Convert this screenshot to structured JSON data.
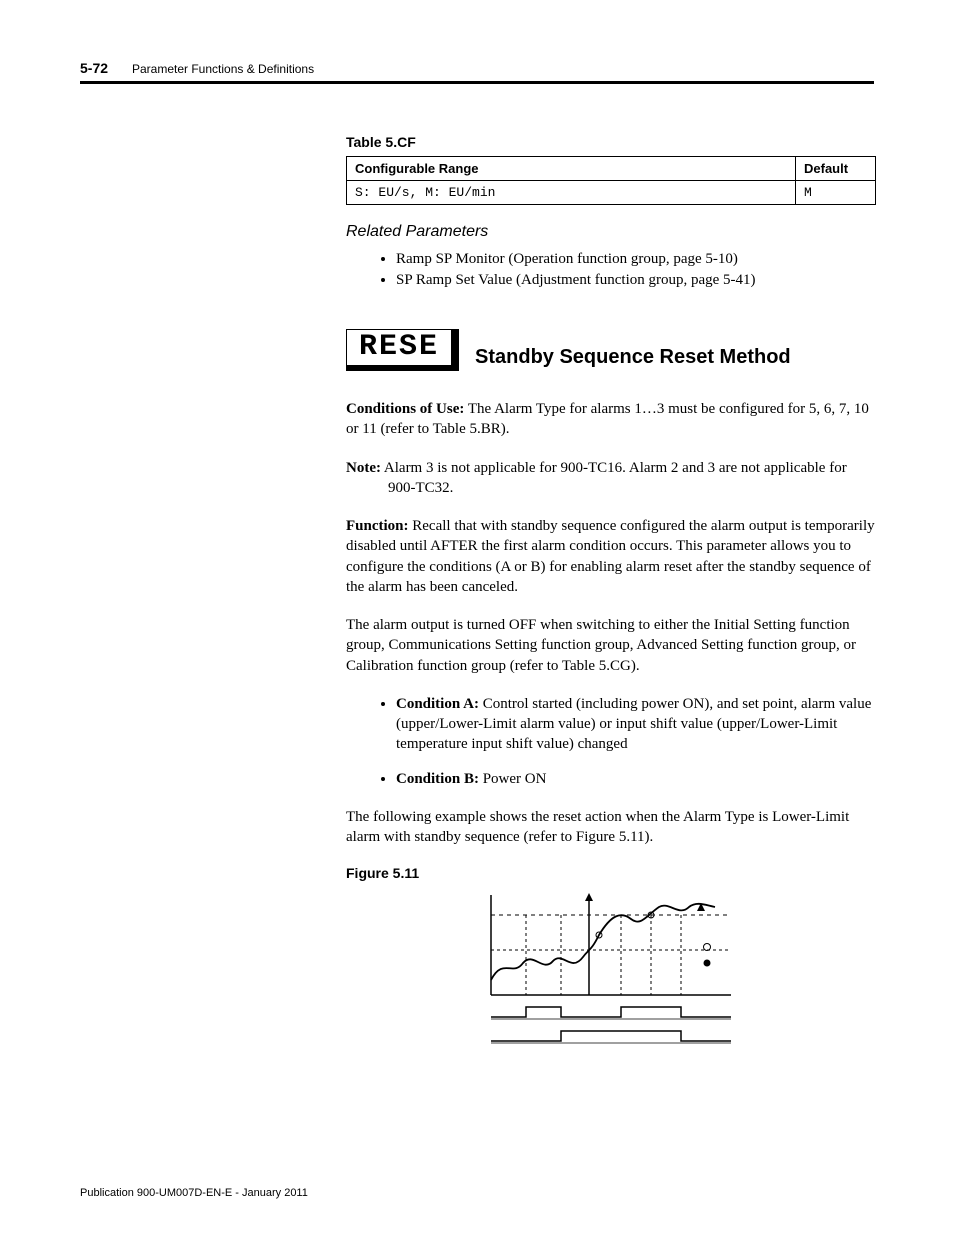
{
  "header": {
    "page_number": "5-72",
    "chapter": "Parameter Functions & Definitions"
  },
  "table_cf": {
    "caption": "Table 5.CF",
    "col_range": "Configurable Range",
    "col_default": "Default",
    "row_range": "S: EU/s, M: EU/min",
    "row_default": "M"
  },
  "related": {
    "heading": "Related Parameters",
    "items": [
      "Ramp SP Monitor (Operation function group, page 5-10)",
      "SP Ramp Set Value (Adjustment function group, page 5-41)"
    ]
  },
  "section": {
    "seg_text": "RESE",
    "title": "Standby Sequence Reset Method"
  },
  "body": {
    "cond_label": "Conditions of Use:",
    "cond_text": " The Alarm Type for alarms 1…3 must be configured for 5, 6, 7, 10 or 11 (refer to Table 5.BR).",
    "note_label": "Note:",
    "note_text": " Alarm 3 is not applicable for 900-TC16. Alarm 2 and 3 are not applicable for 900-TC32.",
    "func_label": "Function:",
    "func_text": " Recall that with standby sequence configured the alarm output is temporarily disabled until AFTER the first alarm condition occurs. This parameter allows you to configure the conditions (A or B) for enabling alarm reset after the standby sequence of the alarm has been canceled.",
    "para2": "The alarm output is turned OFF when switching to either the Initial Setting function group, Communications Setting function group, Advanced Setting function group, or Calibration function group (refer to Table 5.CG).",
    "conditions": [
      {
        "label": "Condition A:",
        "text": " Control started (including power ON), and set point, alarm value (upper/Lower-Limit alarm value) or input shift value (upper/Lower-Limit temperature input shift value) changed"
      },
      {
        "label": "Condition B:",
        "text": " Power ON"
      }
    ],
    "para3": "The following example shows the reset action when the Alarm Type is Lower-Limit alarm with standby sequence (refer to Figure 5.11)."
  },
  "figure": {
    "caption": "Figure 5.11"
  },
  "chart_data": {
    "type": "line",
    "title": "",
    "xlabel": "",
    "ylabel": "",
    "series": [
      {
        "name": "PV trace",
        "description": "Process value curve rising with oscillations, crossing alarm and setpoint thresholds"
      }
    ],
    "thresholds": [
      {
        "name": "Alarm threshold (upper dashed)",
        "style": "dashed"
      },
      {
        "name": "Set point (lower dashed)",
        "style": "dashed"
      }
    ],
    "digital_traces": [
      {
        "name": "Output A",
        "pattern": [
          0,
          1,
          0,
          1,
          0
        ]
      },
      {
        "name": "Output B",
        "pattern": [
          0,
          0,
          1,
          1,
          0
        ]
      }
    ],
    "markers": [
      {
        "name": "hollow-circle"
      },
      {
        "name": "filled-circle"
      }
    ]
  },
  "footer": {
    "pub": "Publication 900-UM007D-EN-E - January 2011"
  }
}
